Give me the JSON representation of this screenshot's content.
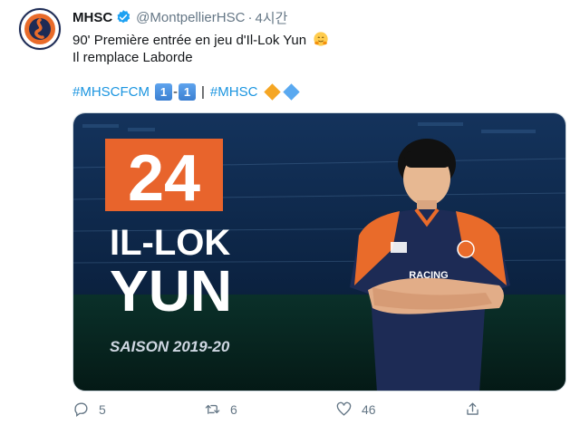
{
  "tweet": {
    "display_name": "MHSC",
    "handle": "@MontpellierHSC",
    "separator": "·",
    "time": "4시간",
    "text_line1": "90' Première entrée en jeu d'Il-Lok Yun",
    "text_line2": "Il remplace Laborde",
    "hashtag1": "#MHSCFCM",
    "score_home": "1",
    "score_dash": "-",
    "score_away": "1",
    "separator_bar": "|",
    "hashtag2": "#MHSC"
  },
  "media": {
    "number": "24",
    "first_name": "IL-LOK",
    "last_name": "YUN",
    "season": "SAISON 2019-20",
    "jersey_sponsor": "RACING",
    "colors": {
      "background": "#0d2240",
      "accent": "#e8642c",
      "jersey_navy": "#1d2b55",
      "jersey_orange": "#e96b2a"
    }
  },
  "actions": {
    "reply_count": "5",
    "retweet_count": "6",
    "like_count": "46"
  },
  "colors": {
    "link": "#1b95e0",
    "muted": "#657786",
    "verified": "#1da1f2"
  }
}
